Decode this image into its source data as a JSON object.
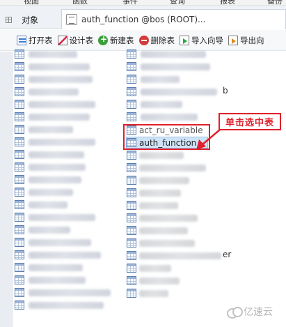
{
  "menubar": [
    "视图",
    "函数",
    "事件",
    "查询",
    "报表",
    "备份"
  ],
  "tabs": {
    "objects_label": "对象",
    "query_tab_title": "auth_function @bos (ROOT)..."
  },
  "toolbar": {
    "open_table": "打开表",
    "design_table": "设计表",
    "new_table": "新建表",
    "delete_table": "删除表",
    "import_wizard": "导入向导",
    "export_wizard": "导出向"
  },
  "tables": {
    "visible_right": [
      "act_ru_variable",
      "auth_function"
    ],
    "selected": "auth_function",
    "peek_fragments": [
      "b",
      "er"
    ]
  },
  "annotation": {
    "callout_text": "单击选中表",
    "accent_color": "#e0202c"
  },
  "watermark": {
    "text": "亿速云"
  }
}
